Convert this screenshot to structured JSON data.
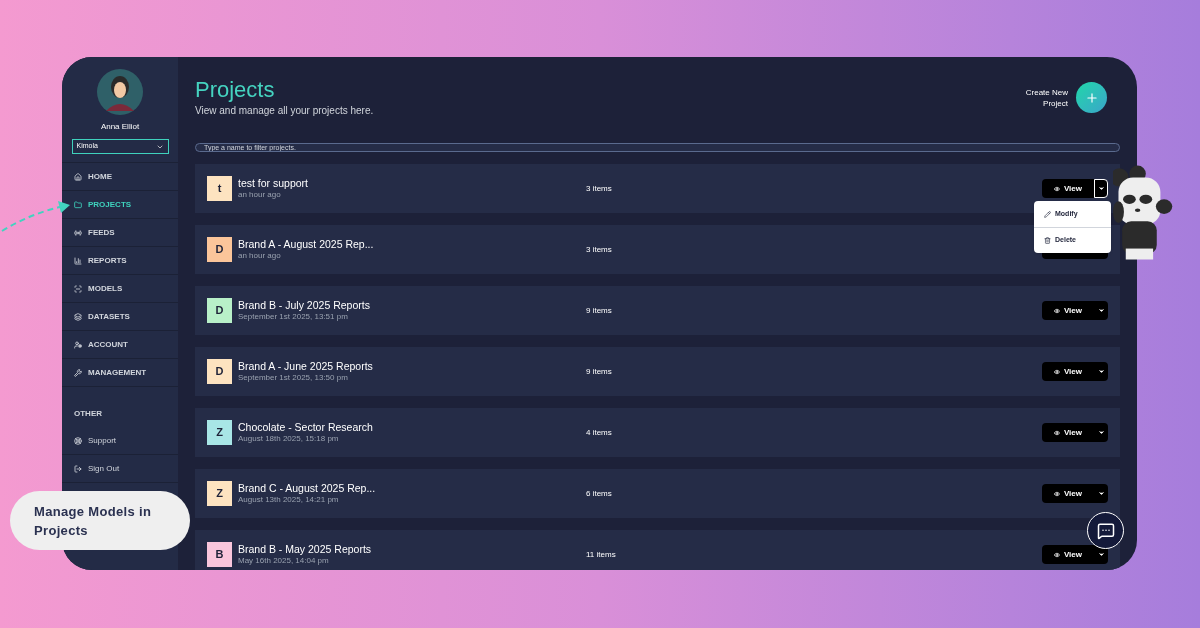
{
  "user": {
    "name": "Anna Elliot",
    "workspace": "Kimola"
  },
  "sidebar": {
    "items": [
      {
        "kind": "nav",
        "label": "HOME",
        "selected": false
      },
      {
        "kind": "nav",
        "label": "PROJECTS",
        "selected": true
      },
      {
        "kind": "nav",
        "label": "FEEDS",
        "selected": false
      },
      {
        "kind": "nav",
        "label": "REPORTS",
        "selected": false
      },
      {
        "kind": "nav",
        "label": "MODELS",
        "selected": false
      },
      {
        "kind": "nav",
        "label": "DATASETS",
        "selected": false
      },
      {
        "kind": "nav",
        "label": "ACCOUNT",
        "selected": false
      },
      {
        "kind": "nav",
        "label": "MANAGEMENT",
        "selected": false
      },
      {
        "kind": "heading",
        "label": "OTHER"
      },
      {
        "kind": "link",
        "label": "Support",
        "selected": false
      },
      {
        "kind": "link",
        "label": "Sign Out",
        "selected": false
      }
    ]
  },
  "header": {
    "title": "Projects",
    "subtitle": "View and manage all your projects here.",
    "create_button": "Create New Project"
  },
  "search": {
    "placeholder": "Type a name to filter projects."
  },
  "projects": [
    {
      "initial": "t",
      "color": "#fde3c0",
      "name": "test for support",
      "date": "an hour ago",
      "items": "3 items",
      "action": "View",
      "menu_open": true
    },
    {
      "initial": "D",
      "color": "#fbc59a",
      "name": "Brand A - August 2025 Rep...",
      "date": "an hour ago",
      "items": "3 items",
      "menu_open": false
    },
    {
      "initial": "D",
      "color": "#b8f0c8",
      "name": "Brand B - July 2025 Reports",
      "date": "September 1st 2025, 13:51 pm",
      "items": "9 items",
      "action": "View",
      "menu_open": false
    },
    {
      "initial": "D",
      "color": "#fde3c0",
      "name": "Brand A - June 2025 Reports",
      "date": "September 1st 2025, 13:50 pm",
      "items": "9 items",
      "action": "View",
      "menu_open": false
    },
    {
      "initial": "Z",
      "color": "#a8e6e6",
      "name": "Chocolate - Sector Research",
      "date": "August 18th 2025, 15:18 pm",
      "items": "4 items",
      "action": "View",
      "menu_open": false
    },
    {
      "initial": "Z",
      "color": "#fde3c0",
      "name": "Brand C - August 2025 Rep...",
      "date": "August 13th 2025, 14:21 pm",
      "items": "6 items",
      "action": "View",
      "menu_open": false
    },
    {
      "initial": "B",
      "color": "#f9c6dc",
      "name": "Brand B - May 2025 Reports",
      "date": "May 16th 2025, 14:04 pm",
      "items": "11 items",
      "action": "View",
      "menu_open": false
    }
  ],
  "row_menu": [
    "Modify",
    "Delete"
  ],
  "callout": "Manage Models in Projects"
}
